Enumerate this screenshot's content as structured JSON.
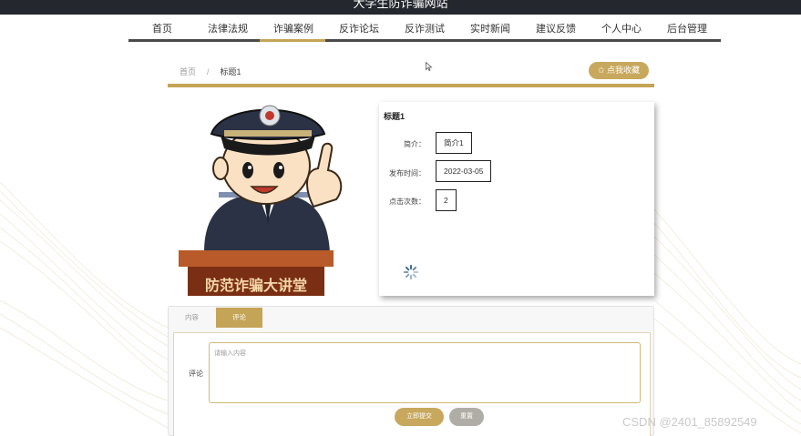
{
  "header": {
    "site_title": "大学生防诈骗网站"
  },
  "nav": {
    "items": [
      {
        "label": "首页"
      },
      {
        "label": "法律法规"
      },
      {
        "label": "诈骗案例"
      },
      {
        "label": "反诈论坛"
      },
      {
        "label": "反诈测试"
      },
      {
        "label": "实时新闻"
      },
      {
        "label": "建议反馈"
      },
      {
        "label": "个人中心"
      },
      {
        "label": "后台管理"
      }
    ],
    "active_index": 2
  },
  "breadcrumb": {
    "home": "首页",
    "separator": "/",
    "current": "标题1"
  },
  "favorite_button": {
    "label": "✩ 点我收藏"
  },
  "poster": {
    "banner_text": "防范诈骗大讲堂"
  },
  "detail": {
    "title": "标题1",
    "fields": [
      {
        "label": "简介：",
        "value": "简介1"
      },
      {
        "label": "发布时间：",
        "value": "2022-03-05"
      },
      {
        "label": "点击次数：",
        "value": "2"
      }
    ]
  },
  "tabs": {
    "content_label": "内容",
    "comment_label": "评论"
  },
  "comment_form": {
    "label": "评论",
    "placeholder": "请输入内容",
    "submit_label": "立即提交",
    "reset_label": "重置"
  },
  "watermark": "CSDN @2401_85892549",
  "colors": {
    "accent_gold": "#c4a456",
    "topbar": "#24282e",
    "nav_underline": "#4a4a4a"
  }
}
